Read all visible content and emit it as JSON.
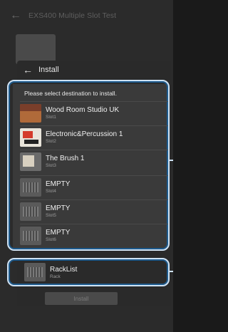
{
  "background": {
    "title": "EXS400 Multiple Slot Test"
  },
  "dialog": {
    "title": "Install",
    "prompt": "Please select destination to install.",
    "slots": [
      {
        "name": "Wood Room Studio UK",
        "sub": "Slot1",
        "thumb": "wood"
      },
      {
        "name": "Electronic&Percussion 1",
        "sub": "Slot2",
        "thumb": "elec"
      },
      {
        "name": "The Brush 1",
        "sub": "Slot3",
        "thumb": "brush"
      },
      {
        "name": "EMPTY",
        "sub": "Slot4",
        "thumb": "empty"
      },
      {
        "name": "EMPTY",
        "sub": "Slot5",
        "thumb": "empty"
      },
      {
        "name": "EMPTY",
        "sub": "Slot6",
        "thumb": "empty"
      }
    ],
    "rack": {
      "name": "RackList",
      "sub": "Rack"
    },
    "install_button": "Install"
  },
  "colors": {
    "highlight": "#cfe3f5",
    "highlight_inner": "#1e5a8c"
  }
}
